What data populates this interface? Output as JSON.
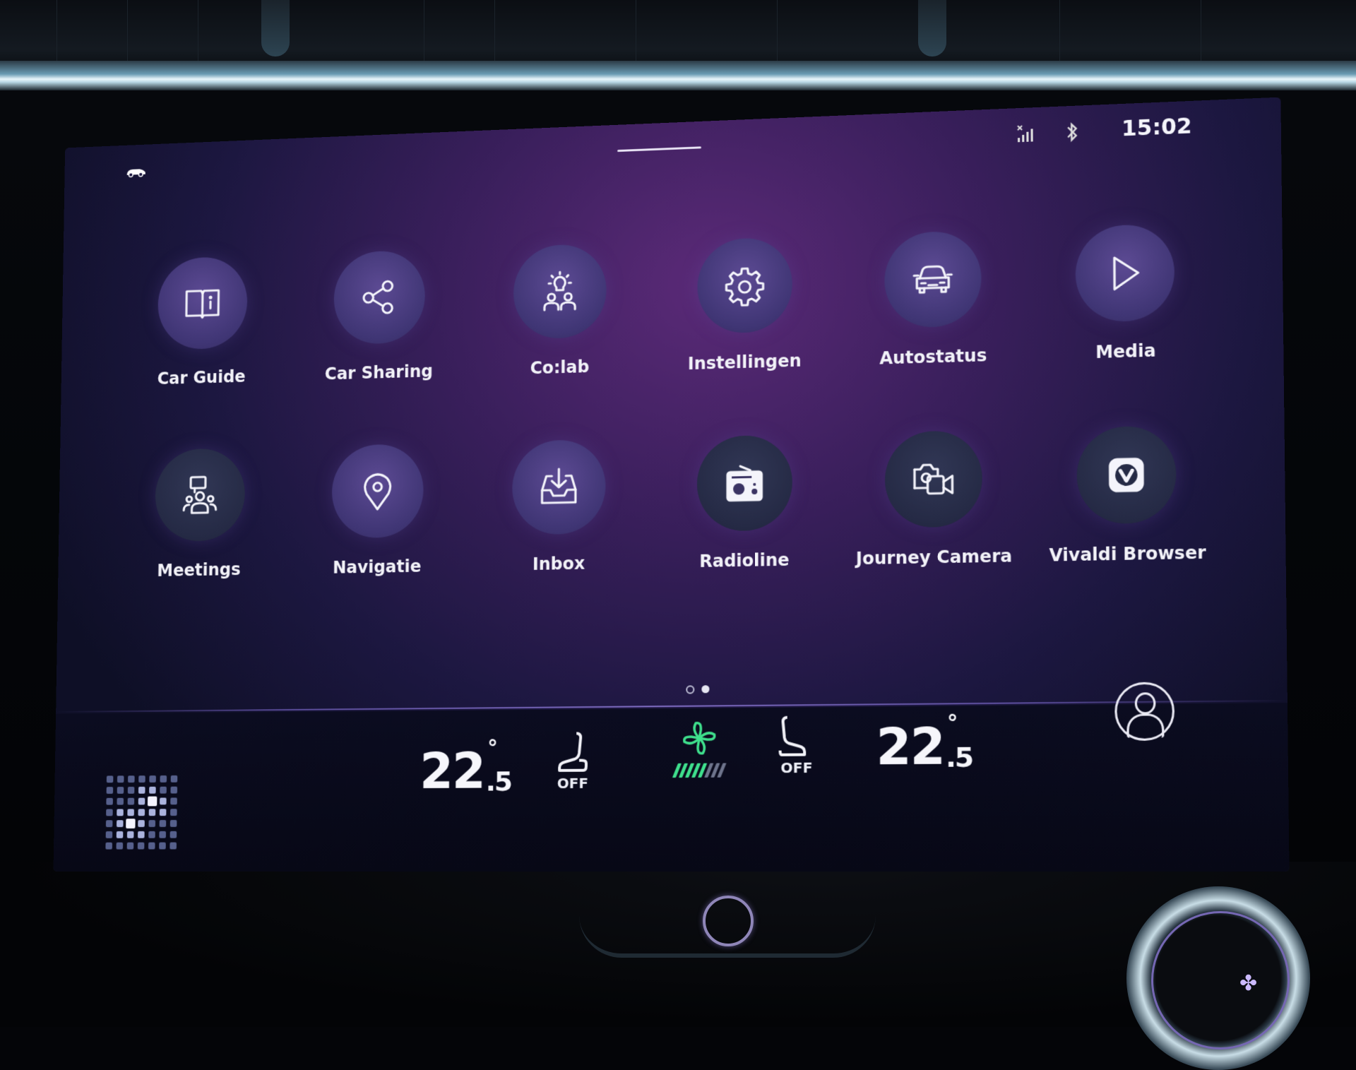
{
  "status_bar": {
    "car_icon": "car-mini-icon",
    "signal_icon": "no-signal-icon",
    "bluetooth_icon": "bluetooth-icon",
    "time": "15:02"
  },
  "apps": [
    {
      "label": "Car Guide",
      "icon": "book-info-icon"
    },
    {
      "label": "Car Sharing",
      "icon": "share-icon"
    },
    {
      "label": "Co:lab",
      "icon": "idea-people-icon"
    },
    {
      "label": "Instellingen",
      "icon": "gear-icon"
    },
    {
      "label": "Autostatus",
      "icon": "car-front-icon"
    },
    {
      "label": "Media",
      "icon": "play-icon"
    },
    {
      "label": "Meetings",
      "icon": "meeting-icon"
    },
    {
      "label": "Navigatie",
      "icon": "location-pin-icon"
    },
    {
      "label": "Inbox",
      "icon": "inbox-download-icon"
    },
    {
      "label": "Radioline",
      "icon": "radio-icon"
    },
    {
      "label": "Journey Camera",
      "icon": "camera-video-icon"
    },
    {
      "label": "Vivaldi Browser",
      "icon": "vivaldi-icon"
    }
  ],
  "pager": {
    "pages": 2,
    "current": 2
  },
  "climate": {
    "driver_temp": {
      "whole": "22",
      "fraction": "5",
      "unit": "°"
    },
    "driver_seat_heat": "OFF",
    "fan_speed": {
      "level": 5,
      "max": 8
    },
    "passenger_seat_heat": "OFF",
    "passenger_temp": {
      "whole": "22",
      "fraction": "5",
      "unit": "°"
    }
  },
  "colors": {
    "accent_green": "#3fe08d",
    "background_purple": "#3a1f5c"
  }
}
